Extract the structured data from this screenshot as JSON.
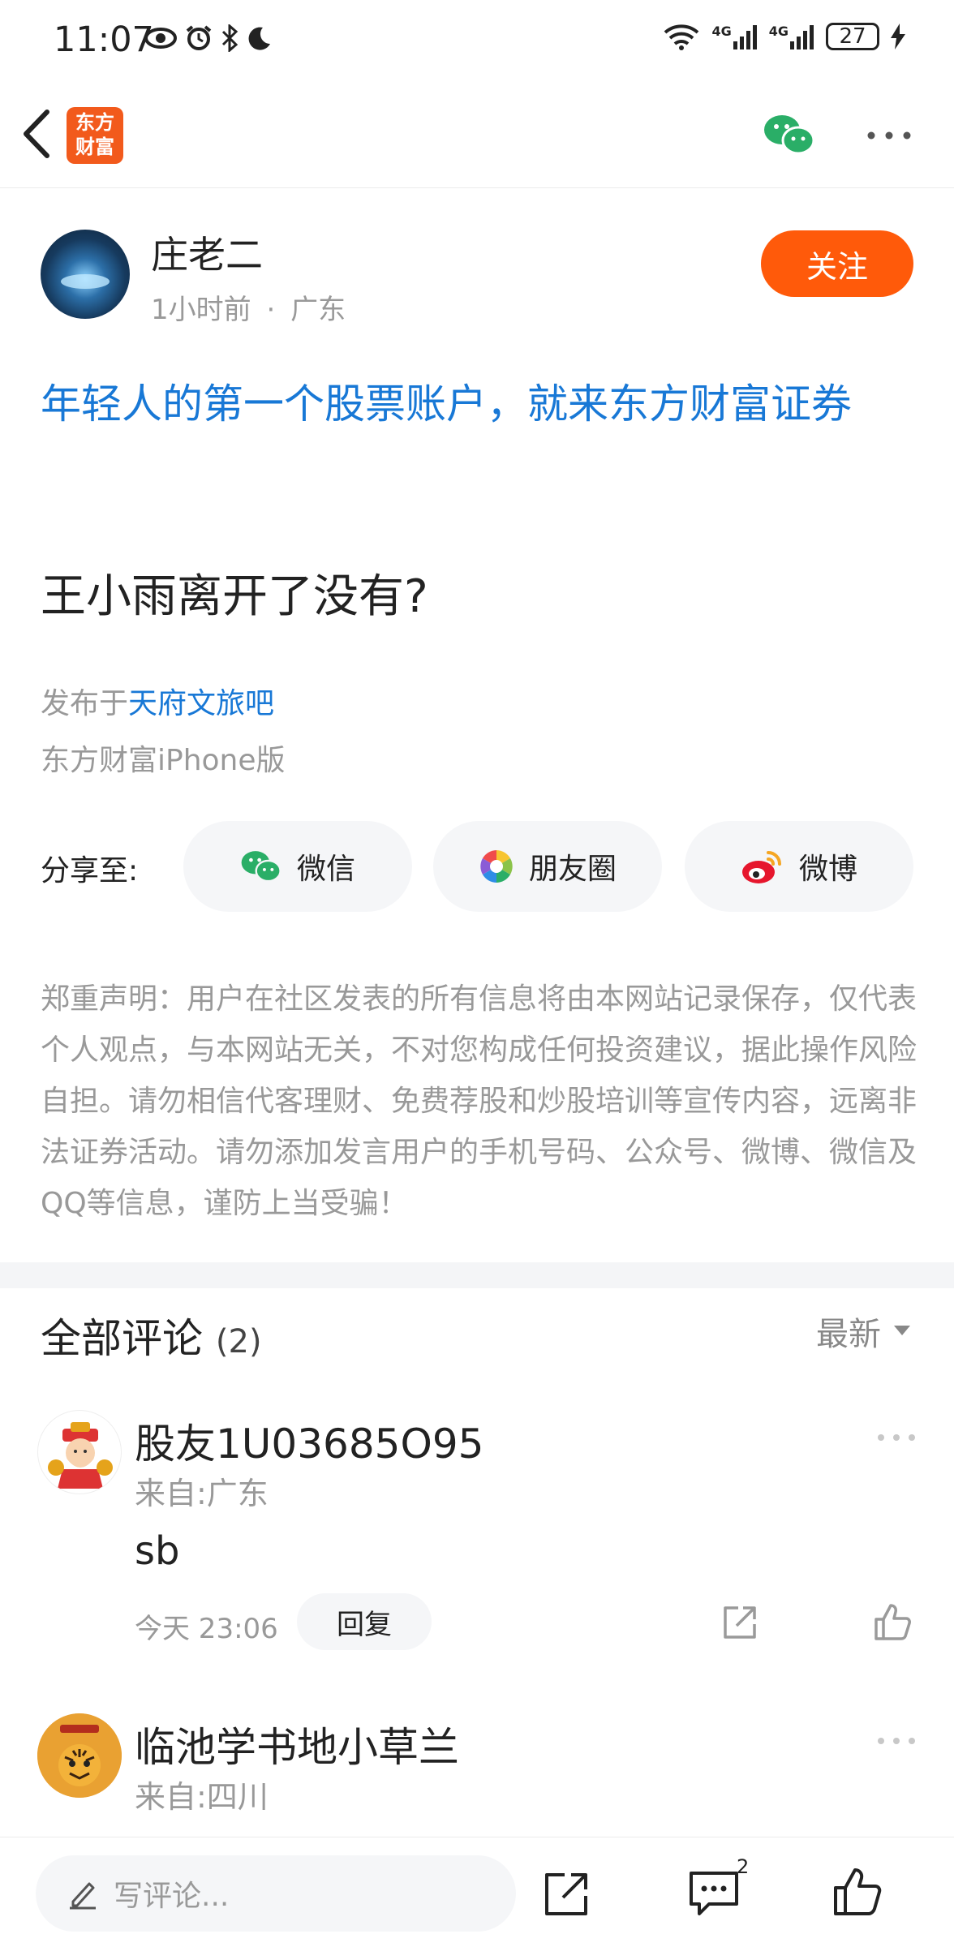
{
  "status_bar": {
    "time": "11:07",
    "network_1": "4G",
    "network_2": "4G",
    "battery": "27"
  },
  "header": {
    "logo_text": "东方财富"
  },
  "post": {
    "author": "庄老二",
    "time": "1小时前",
    "separator": "·",
    "location": "广东",
    "follow_label": "关注",
    "ad_text": "年轻人的第一个股票账户，就来东方财富证券",
    "title": "王小雨离开了没有?",
    "published_prefix": "发布于",
    "published_bar": "天府文旅吧",
    "device": "东方财富iPhone版"
  },
  "share": {
    "label": "分享至:",
    "wechat": "微信",
    "moments": "朋友圈",
    "weibo": "微博"
  },
  "disclaimer": "郑重声明：用户在社区发表的所有信息将由本网站记录保存，仅代表个人观点，与本网站无关，不对您构成任何投资建议，据此操作风险自担。请勿相信代客理财、免费荐股和炒股培训等宣传内容，远离非法证券活动。请勿添加发言用户的手机号码、公众号、微博、微信及QQ等信息，谨防上当受骗！",
  "comments": {
    "title": "全部评论",
    "count": "(2)",
    "sort": "最新",
    "items": [
      {
        "user": "股友1U03685O95",
        "location": "来自:广东",
        "text": "sb",
        "time": "今天 23:06",
        "reply": "回复"
      },
      {
        "user": "临池学书地小草兰",
        "location": "来自:四川",
        "text": "",
        "time": "",
        "reply": ""
      }
    ]
  },
  "bottom": {
    "placeholder": "写评论...",
    "comment_badge": "2"
  },
  "colors": {
    "accent": "#ff5a0a",
    "link": "#1878d6",
    "wechat": "#2aae67"
  }
}
